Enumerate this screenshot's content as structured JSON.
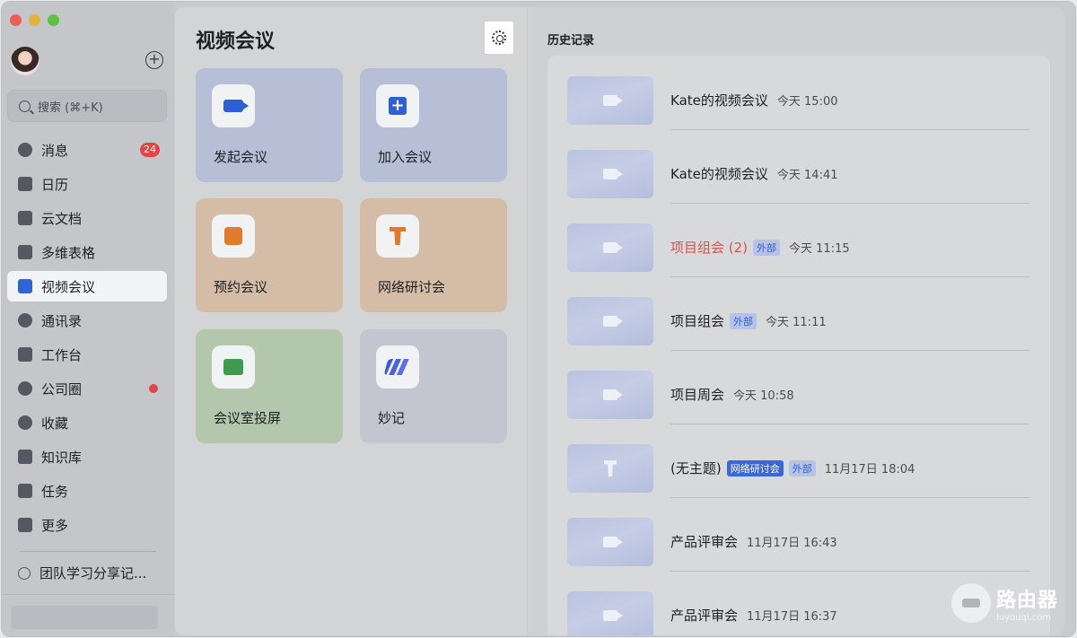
{
  "sidebar": {
    "search_placeholder": "搜索 (⌘+K)",
    "items": [
      {
        "label": "消息",
        "badge": "24"
      },
      {
        "label": "日历"
      },
      {
        "label": "云文档"
      },
      {
        "label": "多维表格"
      },
      {
        "label": "视频会议"
      },
      {
        "label": "通讯录"
      },
      {
        "label": "工作台"
      },
      {
        "label": "公司圈"
      },
      {
        "label": "收藏"
      },
      {
        "label": "知识库"
      },
      {
        "label": "任务"
      },
      {
        "label": "更多"
      }
    ],
    "link": "团队学习分享记..."
  },
  "mid": {
    "title": "视频会议",
    "tiles": [
      {
        "label": "发起会议"
      },
      {
        "label": "加入会议"
      },
      {
        "label": "预约会议"
      },
      {
        "label": "网络研讨会"
      },
      {
        "label": "会议室投屏"
      },
      {
        "label": "妙记"
      }
    ]
  },
  "history": {
    "title": "历史记录",
    "rows": [
      {
        "name": "Kate的视频会议",
        "time": "今天 15:00"
      },
      {
        "name": "Kate的视频会议",
        "time": "今天 14:41"
      },
      {
        "name": "项目组会 (2)",
        "tag": "外部",
        "time": "今天 11:15"
      },
      {
        "name": "项目组会",
        "tag": "外部",
        "time": "今天 11:11"
      },
      {
        "name": "项目周会",
        "time": "今天 10:58"
      },
      {
        "name": "(无主题)",
        "tag_solid": "网络研讨会",
        "tag": "外部",
        "time": "11月17日 18:04"
      },
      {
        "name": "产品评审会",
        "time": "11月17日 16:43"
      },
      {
        "name": "产品评审会",
        "time": "11月17日 16:37"
      }
    ]
  },
  "watermark": {
    "title": "路由器",
    "url": "luyouqi.com"
  },
  "colors": {
    "accent": "#2f5fd6",
    "badge": "#e04646",
    "highlight_name": "#d9534f"
  }
}
